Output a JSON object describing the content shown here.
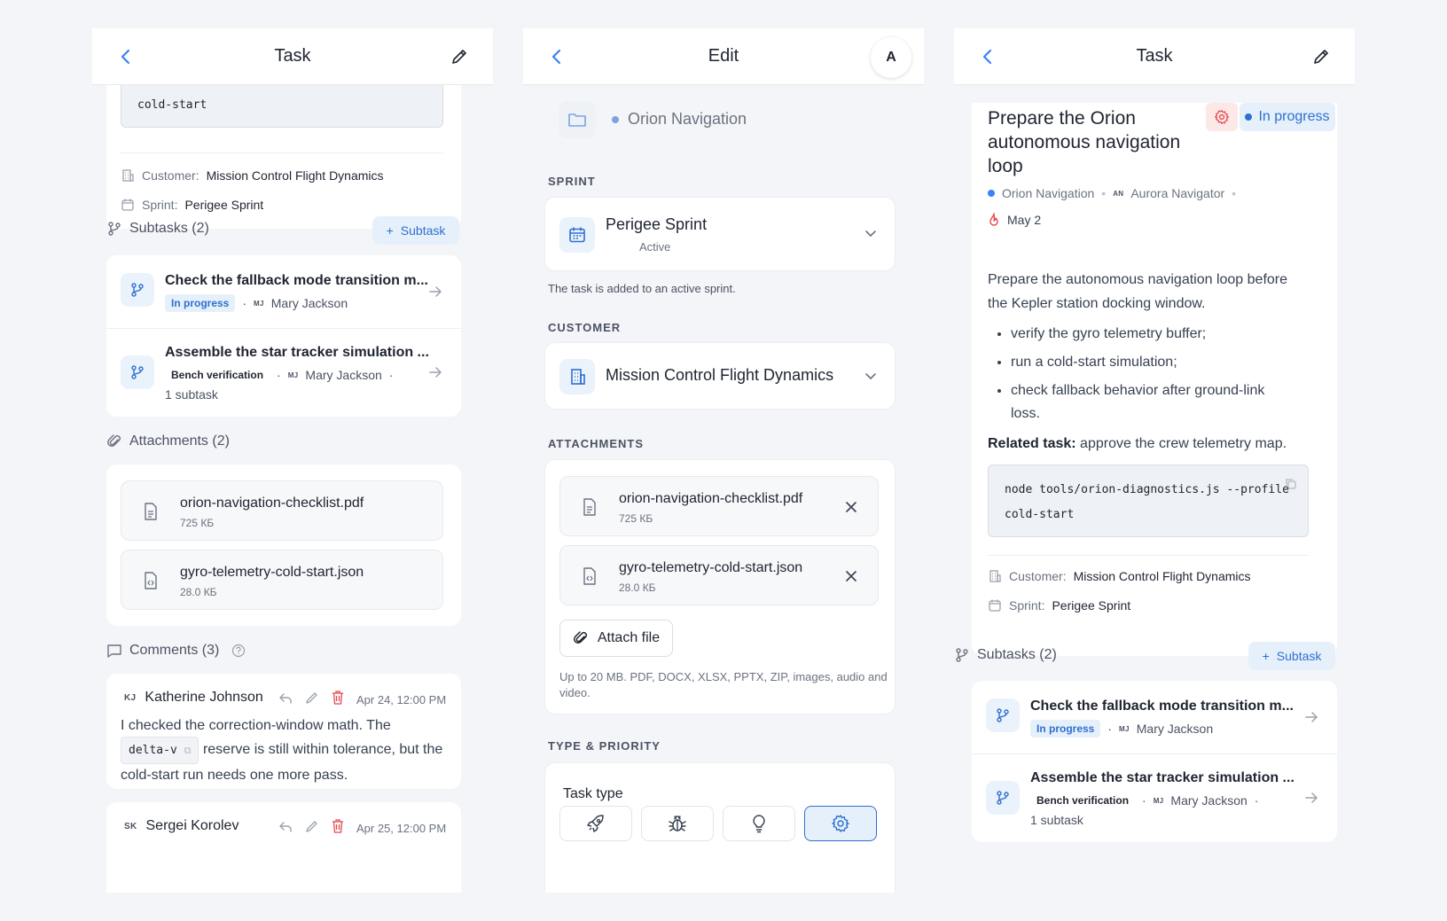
{
  "screen1": {
    "title": "Task",
    "code_tail": "cold-start",
    "customer_label": "Customer:",
    "customer_value": "Mission Control Flight Dynamics",
    "sprint_label": "Sprint:",
    "sprint_value": "Perigee Sprint",
    "subtasks_heading": "Subtasks (2)",
    "add_subtask": "Subtask",
    "subtasks": [
      {
        "title": "Check the fallback mode transition m...",
        "status": "In progress",
        "assignee_initials": "MJ",
        "assignee": "Mary Jackson"
      },
      {
        "title": "Assemble the star tracker simulation ...",
        "status": "Bench verification",
        "assignee_initials": "MJ",
        "assignee": "Mary Jackson",
        "extra": "1 subtask"
      }
    ],
    "attachments_heading": "Attachments (2)",
    "attachments": [
      {
        "name": "orion-navigation-checklist.pdf",
        "size": "725 КБ"
      },
      {
        "name": "gyro-telemetry-cold-start.json",
        "size": "28.0 КБ"
      }
    ],
    "comments_heading": "Comments (3)",
    "comments": [
      {
        "initials": "KJ",
        "name": "Katherine Johnson",
        "date": "Apr 24, 12:00 PM",
        "text_a": "I checked the correction-window math. The",
        "code": "delta-v",
        "text_b": "reserve is still within tolerance, but the",
        "text_c": "cold-start run needs one more pass."
      },
      {
        "initials": "SK",
        "name": "Sergei Korolev",
        "date": "Apr 25, 12:00 PM"
      }
    ]
  },
  "screen2": {
    "title": "Edit",
    "avatar_initial": "A",
    "project": "Orion Navigation",
    "sprint_caption": "Sprint",
    "sprint_name": "Perigee Sprint",
    "sprint_state": "Active",
    "sprint_help": "The task is added to an active sprint.",
    "customer_caption": "Customer",
    "customer_name": "Mission Control Flight Dynamics",
    "attachments_caption": "Attachments",
    "attachments": [
      {
        "name": "orion-navigation-checklist.pdf",
        "size": "725 КБ"
      },
      {
        "name": "gyro-telemetry-cold-start.json",
        "size": "28.0 КБ"
      }
    ],
    "attach_button": "Attach file",
    "attach_help_1": "Up to 20 MB. PDF, DOCX, XLSX, PPTX, ZIP, images, audio and",
    "attach_help_2": "video.",
    "type_caption": "Type & Priority",
    "task_type_label": "Task type",
    "task_types": [
      "rocket-icon",
      "bug-icon",
      "lightbulb-icon",
      "gear-icon"
    ],
    "selected_type": "gear-icon"
  },
  "screen3": {
    "title": "Task",
    "task_title_1": "Prepare the Orion",
    "task_title_2": "autonomous navigation",
    "task_title_3": "loop",
    "status": "In progress",
    "project": "Orion Navigation",
    "owner_initials": "AN",
    "owner": "Aurora Navigator",
    "due": "May 2",
    "desc_1": "Prepare the autonomous navigation loop before",
    "desc_2": "the Kepler station docking window.",
    "bullets": [
      "verify the gyro telemetry buffer;",
      "run a cold-start simulation;",
      "check fallback behavior after ground-link",
      "loss."
    ],
    "related_label": "Related task:",
    "related_text": "approve the crew telemetry map.",
    "code_1": "node tools/orion-diagnostics.js --profile",
    "code_2": "cold-start",
    "customer_label": "Customer:",
    "customer_value": "Mission Control Flight Dynamics",
    "sprint_label": "Sprint:",
    "sprint_value": "Perigee Sprint",
    "subtasks_heading": "Subtasks (2)",
    "add_subtask": "Subtask",
    "subtasks": [
      {
        "title": "Check the fallback mode transition m...",
        "status": "In progress",
        "assignee_initials": "MJ",
        "assignee": "Mary Jackson"
      },
      {
        "title": "Assemble the star tracker simulation ...",
        "status": "Bench verification",
        "assignee_initials": "MJ",
        "assignee": "Mary Jackson",
        "extra": "1 subtask"
      }
    ]
  },
  "colors": {
    "accent": "#2f6fcf",
    "accent_bg": "#e6f0fb",
    "danger": "#e5484d",
    "background": "#f4f5f8"
  }
}
